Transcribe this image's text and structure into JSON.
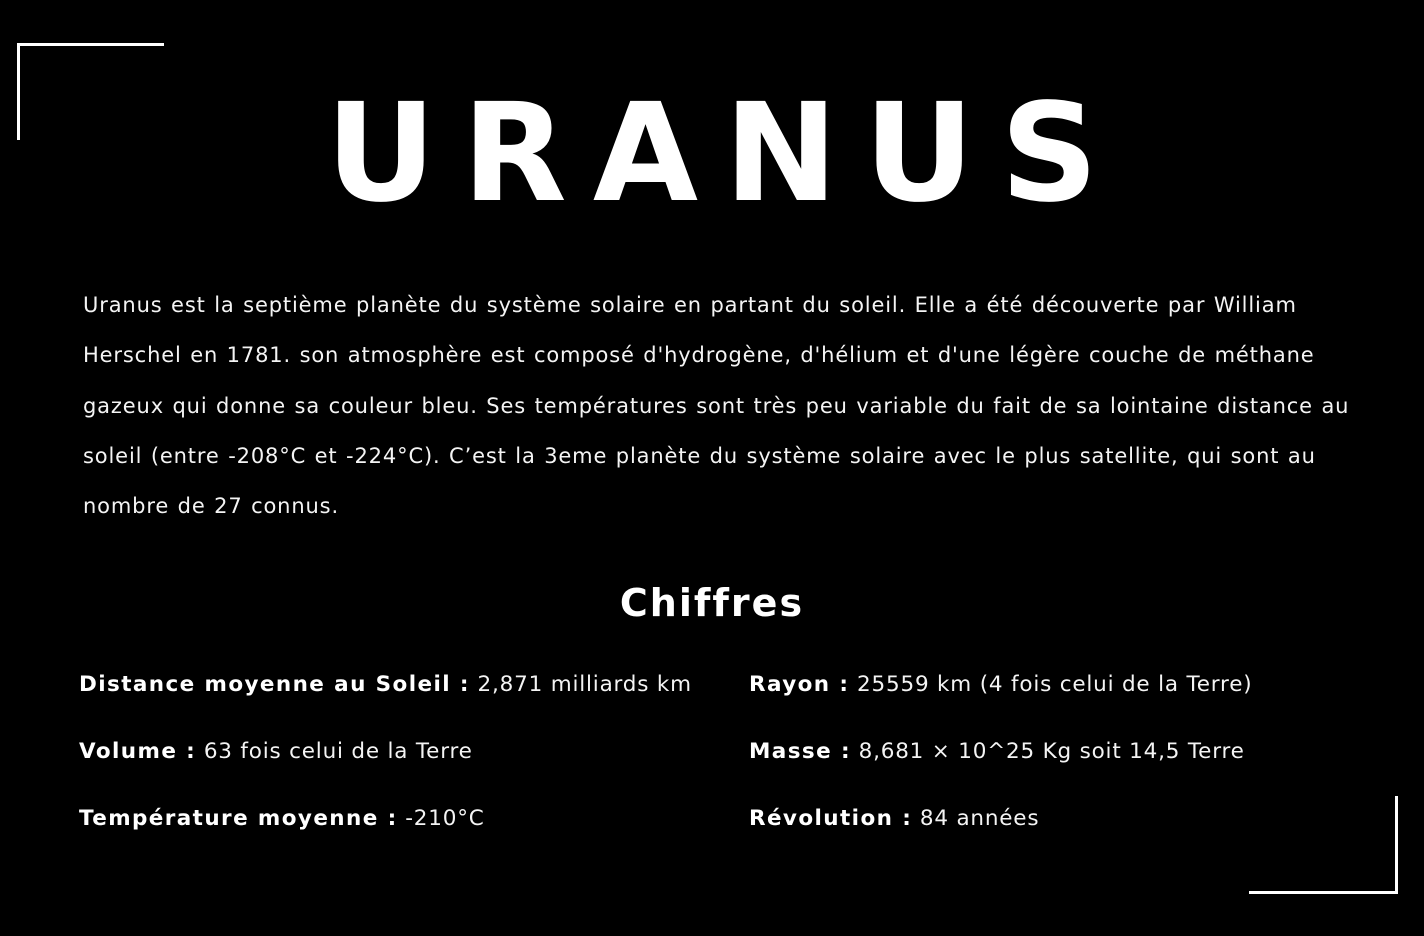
{
  "page": {
    "title": "URANUS",
    "description": "Uranus est la septième planète du système solaire en partant du soleil. Elle a été découverte par William Herschel en 1781. son atmosphère est composé d'hydrogène, d'hélium et d'une légère couche de méthane gazeux qui donne sa couleur bleu. Ses températures sont très peu variable du fait de sa lointaine distance au soleil (entre -208°C et -224°C). C’est la 3eme planète du système solaire avec le plus satellite, qui sont au nombre de 27 connus.",
    "section_title": "Chiffres"
  },
  "stats": {
    "distance": {
      "label": "Distance moyenne au Soleil :",
      "value": "2,871 milliards km"
    },
    "rayon": {
      "label": "Rayon :",
      "value": "25559 km (4 fois celui de la Terre)"
    },
    "volume": {
      "label": "Volume :",
      "value": "63 fois celui de la Terre"
    },
    "masse": {
      "label": "Masse :",
      "value": "8,681 × 10^25 Kg soit 14,5 Terre"
    },
    "temperature": {
      "label": "Température moyenne :",
      "value": "-210°C"
    },
    "revolution": {
      "label": "Révolution :",
      "value": "84 années"
    }
  },
  "colors": {
    "background": "#000000",
    "text": "#ffffff"
  }
}
